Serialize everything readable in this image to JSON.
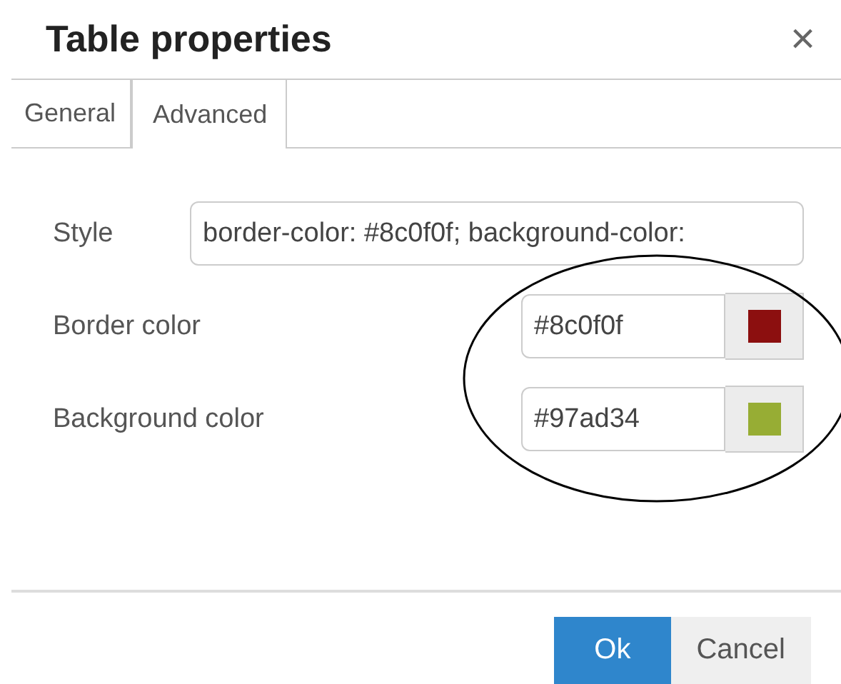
{
  "window": {
    "title": "Table properties",
    "close": "×"
  },
  "tabs": [
    {
      "label": "General",
      "selected": false
    },
    {
      "label": "Advanced",
      "selected": true
    }
  ],
  "style_field": {
    "label": "Style",
    "value": "border-color: #8c0f0f; background-color:"
  },
  "color_fields": [
    {
      "label": "Border color",
      "value": "#8c0f0f",
      "color": "#8c0f0f"
    },
    {
      "label": "Background color",
      "value": "#97ad34",
      "color": "#97ad34"
    }
  ],
  "buttons": [
    {
      "label": "Ok",
      "kind": "primary"
    },
    {
      "label": "Cancel",
      "kind": "secondary"
    }
  ]
}
